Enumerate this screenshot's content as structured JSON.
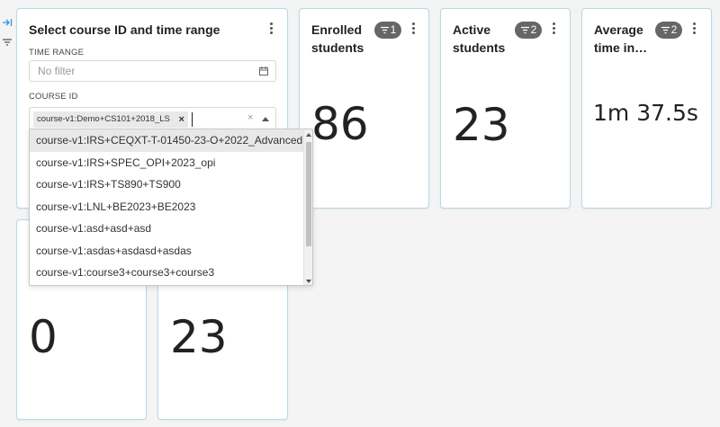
{
  "rail": {
    "expand_icon": "expand-right-icon",
    "filter_icon": "filter-icon"
  },
  "filter_card": {
    "title": "Select course ID and time range",
    "time_range": {
      "label": "TIME RANGE",
      "placeholder": "No filter",
      "icon": "calendar-icon"
    },
    "course_id": {
      "label": "COURSE ID",
      "selected_chip": "course-v1:Demo+CS101+2018_LS",
      "chip_remove": "×",
      "clear": "×"
    },
    "dropdown_options": [
      "course-v1:IRS+CEQXT-T-01450-23-O+2022_Advanced",
      "course-v1:IRS+SPEC_OPI+2023_opi",
      "course-v1:IRS+TS890+TS900",
      "course-v1:LNL+BE2023+BE2023",
      "course-v1:asd+asd+asd",
      "course-v1:asdas+asdasd+asdas",
      "course-v1:course3+course3+course3"
    ],
    "highlighted_index": 0
  },
  "metrics": [
    {
      "title_line1": "Enrolled",
      "title_line2": "students",
      "filter_count": "1",
      "value": "86"
    },
    {
      "title_line1": "Active",
      "title_line2": "students",
      "filter_count": "2",
      "value": "23"
    },
    {
      "title_line1": "Average",
      "title_line2": "time in…",
      "filter_count": "2",
      "value": "1m 37.5s"
    }
  ],
  "bottom_metrics": [
    {
      "value": "0"
    },
    {
      "value": "23"
    }
  ],
  "colors": {
    "card_border": "#b4dbe8",
    "badge_bg": "#666666",
    "rail_accent": "#3a8fd0"
  }
}
